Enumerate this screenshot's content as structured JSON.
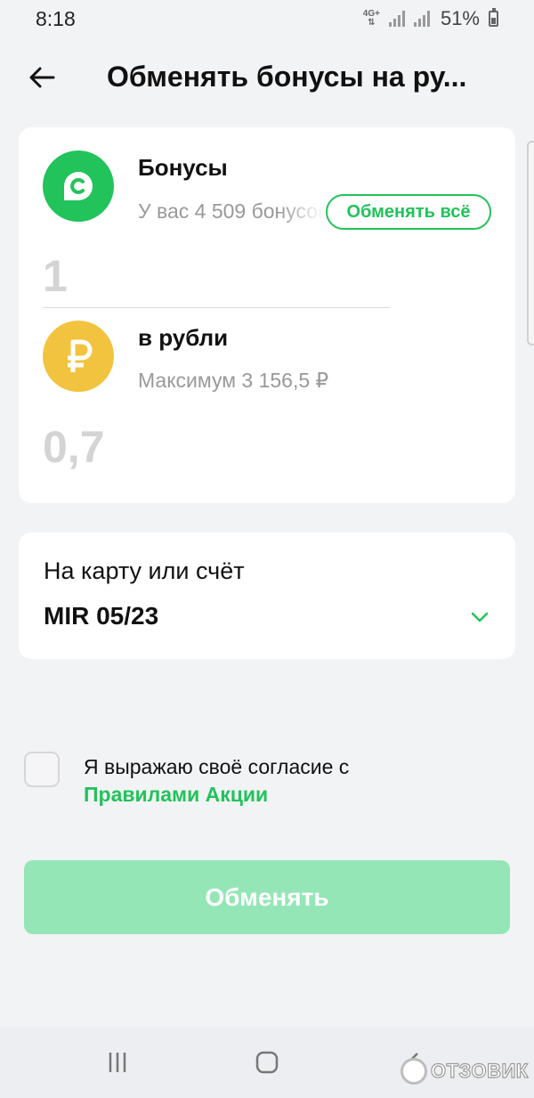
{
  "status_bar": {
    "time": "8:18",
    "network": "4G+",
    "battery_percent": "51%"
  },
  "header": {
    "back_icon": "arrow-left-icon",
    "title": "Обменять бонусы на ру..."
  },
  "exchange": {
    "bonus": {
      "icon": "bonus-c-icon",
      "title": "Бонусы",
      "subtitle": "У вас 4 509 бонусов",
      "exchange_all_label": "Обменять всё",
      "amount": "1"
    },
    "ruble": {
      "icon": "ruble-icon",
      "title": "в рубли",
      "subtitle": "Максимум 3 156,5 ₽",
      "amount": "0,7"
    }
  },
  "account": {
    "label": "На карту или счёт",
    "value": "MIR 05/23",
    "dropdown_icon": "chevron-down-icon"
  },
  "consent": {
    "text": "Я выражаю своё согласие с",
    "link_text": "Правилами Акции",
    "checked": false
  },
  "submit_label": "Обменять",
  "watermark": "ОТЗОВИК",
  "colors": {
    "accent": "#21c35a",
    "button_disabled": "#95e6b6",
    "coin_ruble": "#f2c33e",
    "background": "#f2f3f5"
  }
}
